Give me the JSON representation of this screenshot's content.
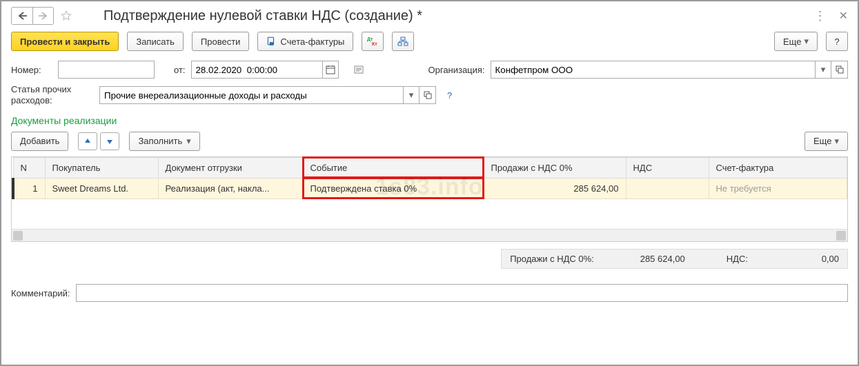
{
  "header": {
    "title": "Подтверждение нулевой ставки НДС (создание) *"
  },
  "toolbar": {
    "post_close": "Провести и закрыть",
    "save": "Записать",
    "post": "Провести",
    "invoices": "Счета-фактуры",
    "more": "Еще",
    "help": "?"
  },
  "fields": {
    "number_label": "Номер:",
    "number_value": "",
    "from_label": "от:",
    "date_value": "28.02.2020  0:00:00",
    "org_label": "Организация:",
    "org_value": "Конфетпром ООО",
    "expense_label": "Статья прочих расходов:",
    "expense_value": "Прочие внереализационные доходы и расходы"
  },
  "section": {
    "title": "Документы реализации",
    "add": "Добавить",
    "fill": "Заполнить",
    "more": "Еще"
  },
  "table": {
    "columns": [
      "N",
      "Покупатель",
      "Документ отгрузки",
      "Событие",
      "Продажи с НДС 0%",
      "НДС",
      "Счет-фактура"
    ],
    "rows": [
      {
        "n": "1",
        "buyer": "Sweet Dreams Ltd.",
        "doc": "Реализация (акт, накла...",
        "event": "Подтверждена ставка 0%",
        "sales": "285 624,00",
        "vat": "",
        "invoice": "Не требуется"
      }
    ]
  },
  "totals": {
    "sales_label": "Продажи с НДС 0%:",
    "sales_value": "285 624,00",
    "vat_label": "НДС:",
    "vat_value": "0,00"
  },
  "footer": {
    "comment_label": "Комментарий:",
    "comment_value": ""
  },
  "watermark": "1s83.info"
}
